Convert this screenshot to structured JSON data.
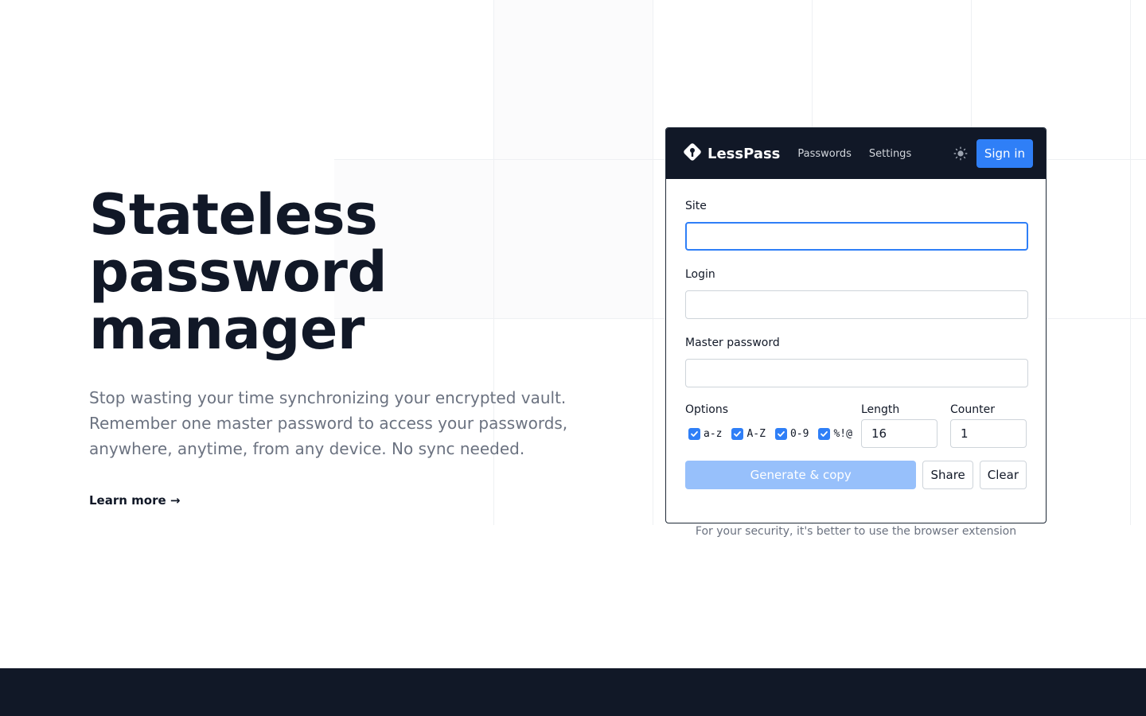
{
  "hero": {
    "title_lines": [
      "Stateless",
      "password",
      "manager"
    ],
    "description": "Stop wasting your time synchronizing your encrypted vault. Remember one master password to access your passwords, anywhere, anytime, from any device. No sync needed.",
    "learn_more": "Learn more →"
  },
  "app": {
    "brand": "LessPass",
    "nav": [
      "Passwords",
      "Settings"
    ],
    "sign_in": "Sign in",
    "form": {
      "site_label": "Site",
      "site_value": "",
      "login_label": "Login",
      "login_value": "",
      "master_label": "Master password",
      "master_value": "",
      "options_label": "Options",
      "options": [
        {
          "label": "a-z",
          "checked": true
        },
        {
          "label": "A-Z",
          "checked": true
        },
        {
          "label": "0-9",
          "checked": true
        },
        {
          "label": "%!@",
          "checked": true
        }
      ],
      "length_label": "Length",
      "length_value": "16",
      "counter_label": "Counter",
      "counter_value": "1",
      "generate_button": "Generate & copy",
      "share_button": "Share",
      "clear_button": "Clear"
    }
  },
  "security_note": "For your security, it's better to use the browser extension",
  "colors": {
    "primary": "#2f7ff7",
    "primary_disabled": "#97c0fb",
    "navbar_bg": "#111827",
    "footer_bg": "#111827",
    "muted_text": "#6b7280"
  }
}
